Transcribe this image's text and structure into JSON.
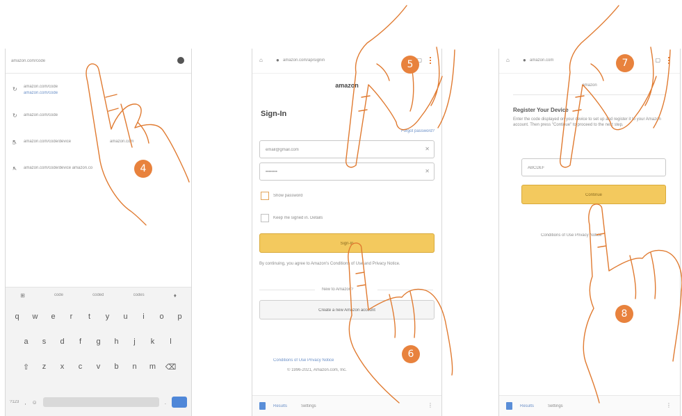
{
  "phone1": {
    "url": "amazon.com/code",
    "suggestions": [
      {
        "line1": "amazon.com/code",
        "line2": "amazon.com/code"
      },
      {
        "line1": "amazon.com/code"
      },
      {
        "line1": "amazon.com/code/device",
        "meta": "amazon.com"
      },
      {
        "line1": "amazon.com/code/device amazon.co"
      }
    ],
    "kbd_suggestions": [
      "code",
      "coded",
      "codes"
    ],
    "row1": [
      "q",
      "w",
      "e",
      "r",
      "t",
      "y",
      "u",
      "i",
      "o",
      "p"
    ],
    "row2": [
      "a",
      "s",
      "d",
      "f",
      "g",
      "h",
      "j",
      "k",
      "l"
    ],
    "row3": [
      "z",
      "x",
      "c",
      "v",
      "b",
      "n",
      "m"
    ],
    "sym_key": "?123"
  },
  "phone2": {
    "url": "amazon.com/ap/signin",
    "logo": "amazon",
    "title": "Sign-In",
    "forgot": "Forgot password?",
    "email": "email@gmail.com",
    "password": "••••••••",
    "show_password": "Show password",
    "keep_signed": "Keep me signed in. Details",
    "signin_btn": "Sign-In",
    "legal": "By continuing, you agree to Amazon's Conditions of Use and Privacy Notice.",
    "new_to": "New to Amazon?",
    "create_btn": "Create a new Amazon account",
    "footer_links": "Conditions of Use   Privacy Notice",
    "copyright": "© 1996-2021, Amazon.com, Inc.",
    "bottom_nav": [
      "Results",
      "Settings"
    ]
  },
  "phone3": {
    "url": "amazon.com",
    "header": "amazon",
    "title": "Register Your Device",
    "desc": "Enter the code displayed on your device to set up and register it to your Amazon account. Then press \"Continue\" to proceed to the next step.",
    "code": "ABCDEF",
    "continue_btn": "Continue",
    "footer": "Conditions of Use  Privacy Notice",
    "bottom_nav": [
      "Results",
      "Settings"
    ]
  },
  "steps": [
    "4",
    "5",
    "6",
    "7",
    "8"
  ],
  "colors": {
    "accent": "#e8823d",
    "button": "#f3c95e"
  }
}
